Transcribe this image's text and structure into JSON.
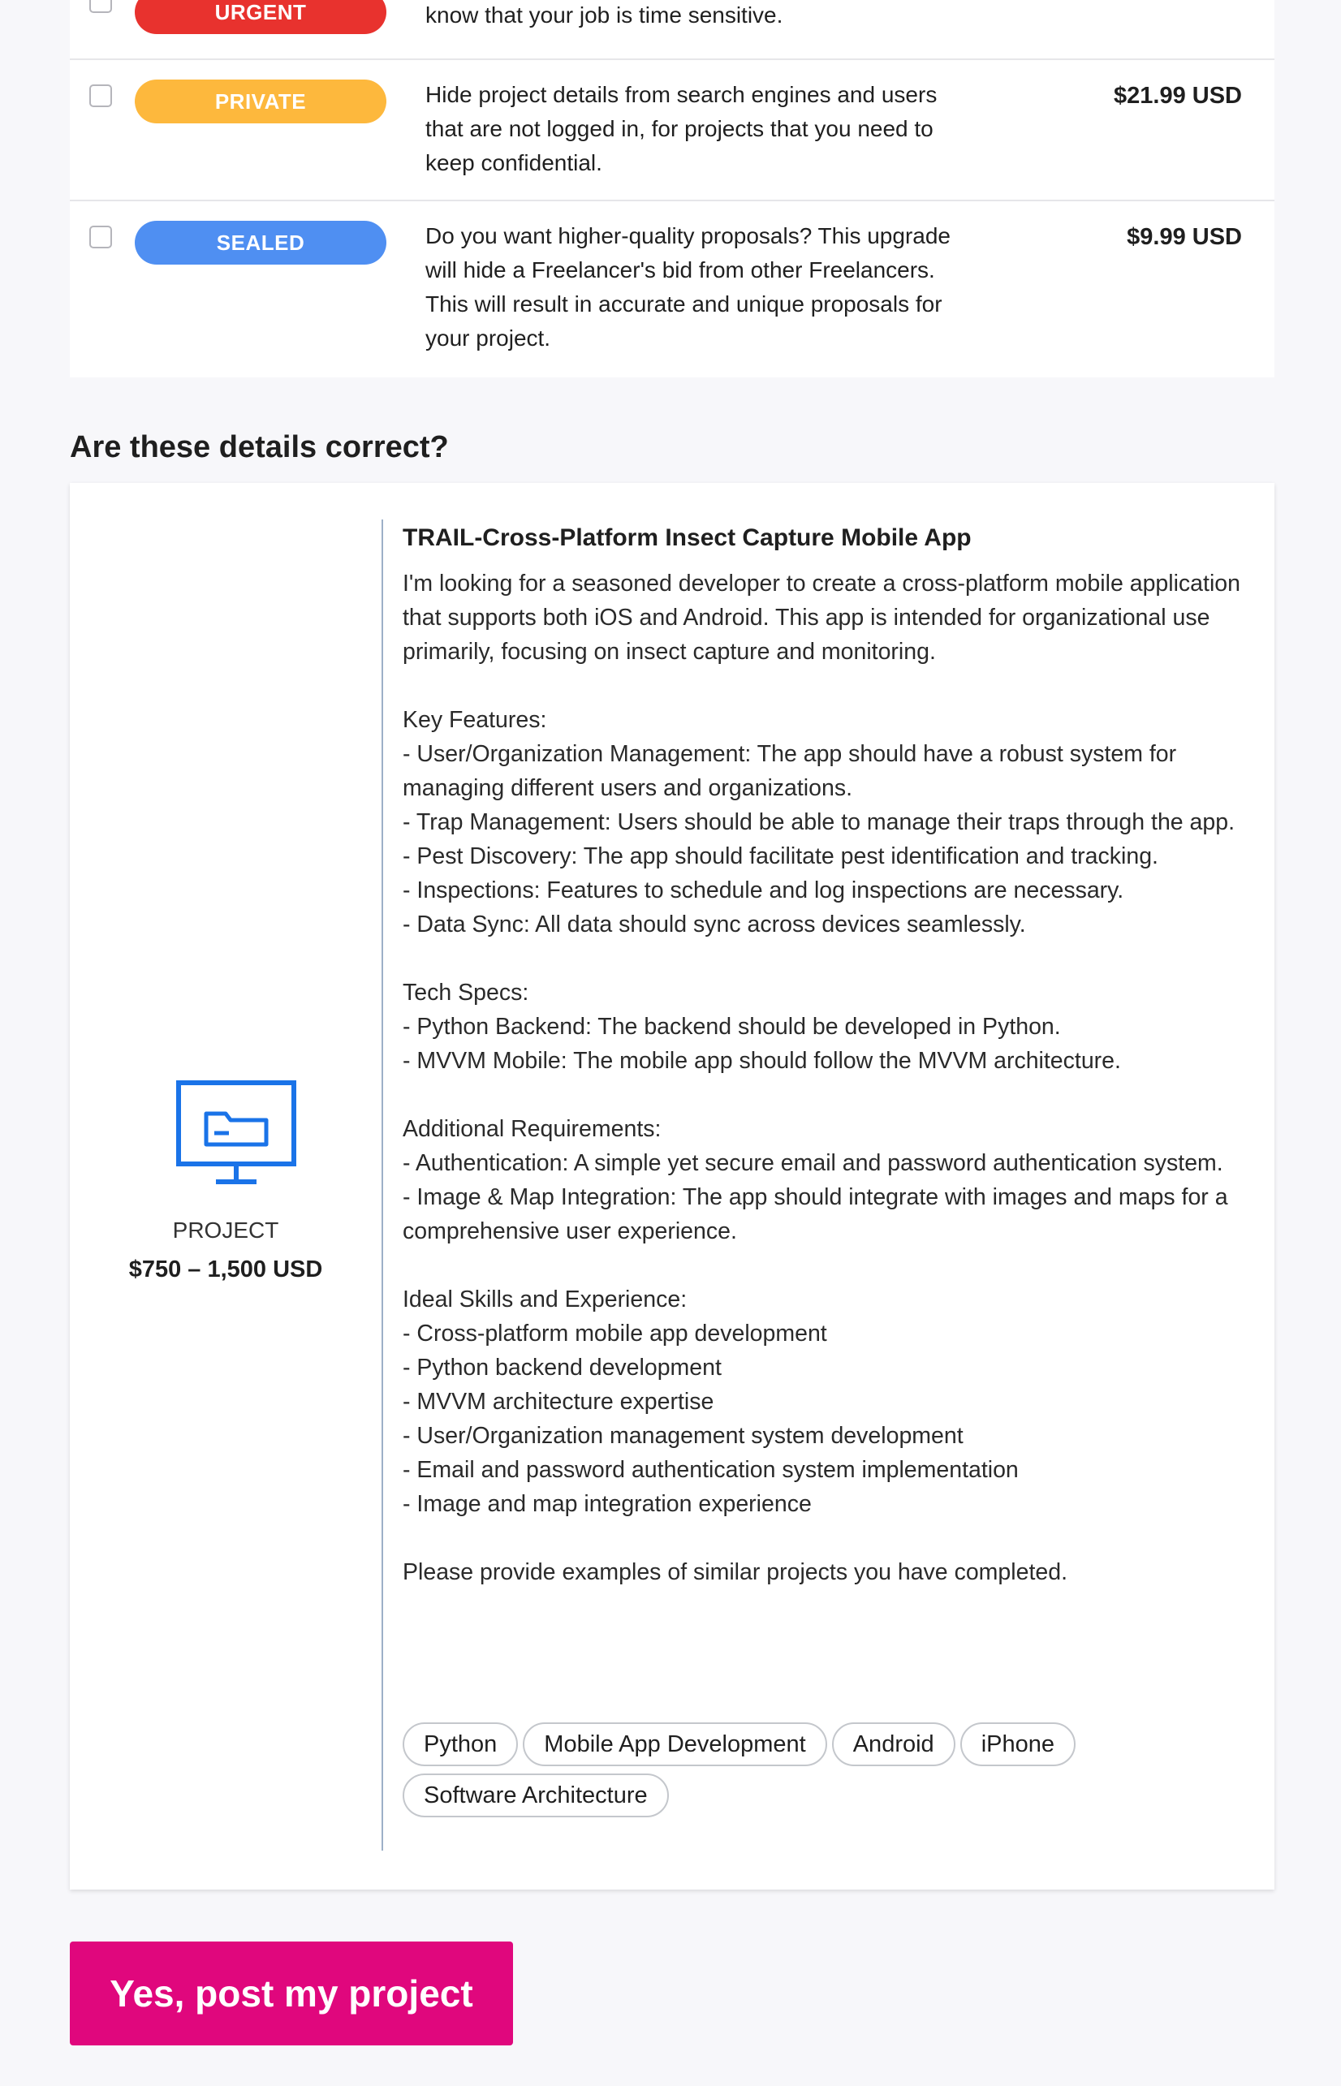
{
  "upgrades": {
    "items": [
      {
        "label": "URGENT",
        "color": "#e8322e",
        "description": "know that your job is time sensitive.",
        "price": ""
      },
      {
        "label": "PRIVATE",
        "color": "#fdb83d",
        "description": "Hide project details from search engines and users that are not logged in, for projects that you need to keep confidential.",
        "price": "$21.99 USD"
      },
      {
        "label": "SEALED",
        "color": "#4f8ff2",
        "description": "Do you want higher-quality proposals? This upgrade will hide a Freelancer's bid from other Freelancers. This will result in accurate and unique proposals for your project.",
        "price": "$9.99 USD"
      }
    ]
  },
  "confirm": {
    "heading": "Are these details correct?"
  },
  "project": {
    "icon": "monitor-folder-icon",
    "type_label": "PROJECT",
    "budget": "$750 – 1,500 USD",
    "title": "TRAIL-Cross-Platform Insect Capture Mobile App",
    "description": "I'm looking for a seasoned developer to create a cross-platform mobile application that supports both iOS and Android. This app is intended for organizational use primarily, focusing on insect capture and monitoring.\n\nKey Features:\n- User/Organization Management: The app should have a robust system for managing different users and organizations.\n- Trap Management: Users should be able to manage their traps through the app.\n- Pest Discovery: The app should facilitate pest identification and tracking.\n- Inspections: Features to schedule and log inspections are necessary.\n- Data Sync: All data should sync across devices seamlessly.\n\nTech Specs:\n- Python Backend: The backend should be developed in Python.\n- MVVM Mobile: The mobile app should follow the MVVM architecture.\n\nAdditional Requirements:\n- Authentication: A simple yet secure email and password authentication system.\n- Image & Map Integration: The app should integrate with images and maps for a comprehensive user experience.\n\nIdeal Skills and Experience:\n- Cross-platform mobile app development\n- Python backend development\n- MVVM architecture expertise\n- User/Organization management system development\n- Email and password authentication system implementation\n- Image and map integration experience\n\nPlease provide examples of similar projects you have completed.",
    "skills": [
      "Python",
      "Mobile App Development",
      "Android",
      "iPhone",
      "Software Architecture"
    ]
  },
  "actions": {
    "post_label": "Yes, post my project",
    "post_color": "#e0077d"
  },
  "colors": {
    "icon_blue": "#1a73e8",
    "divider": "#9db0c8"
  }
}
